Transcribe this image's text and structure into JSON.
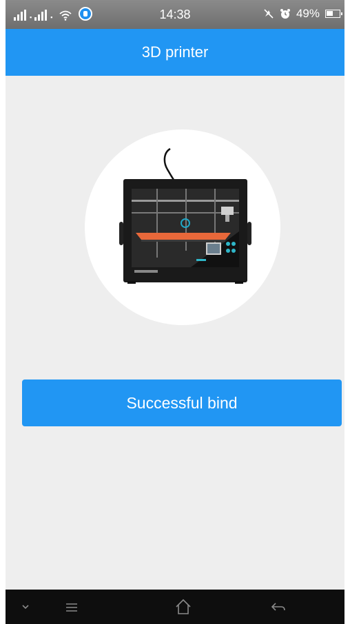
{
  "status_bar": {
    "time": "14:38",
    "battery": "49%",
    "icons": [
      "signal-icon",
      "wifi-icon",
      "app-badge-icon",
      "mute-icon",
      "alarm-icon",
      "battery-icon"
    ]
  },
  "header": {
    "title": "3D printer"
  },
  "main": {
    "device_image": "3d-printer-image",
    "bind_button_label": "Successful bind"
  },
  "nav_bar": {
    "icons": [
      "chevron-down-icon",
      "menu-icon",
      "home-icon",
      "back-icon"
    ]
  },
  "colors": {
    "accent": "#2196f3",
    "background": "#eeeeee",
    "nav_background": "#0e0e0e"
  }
}
